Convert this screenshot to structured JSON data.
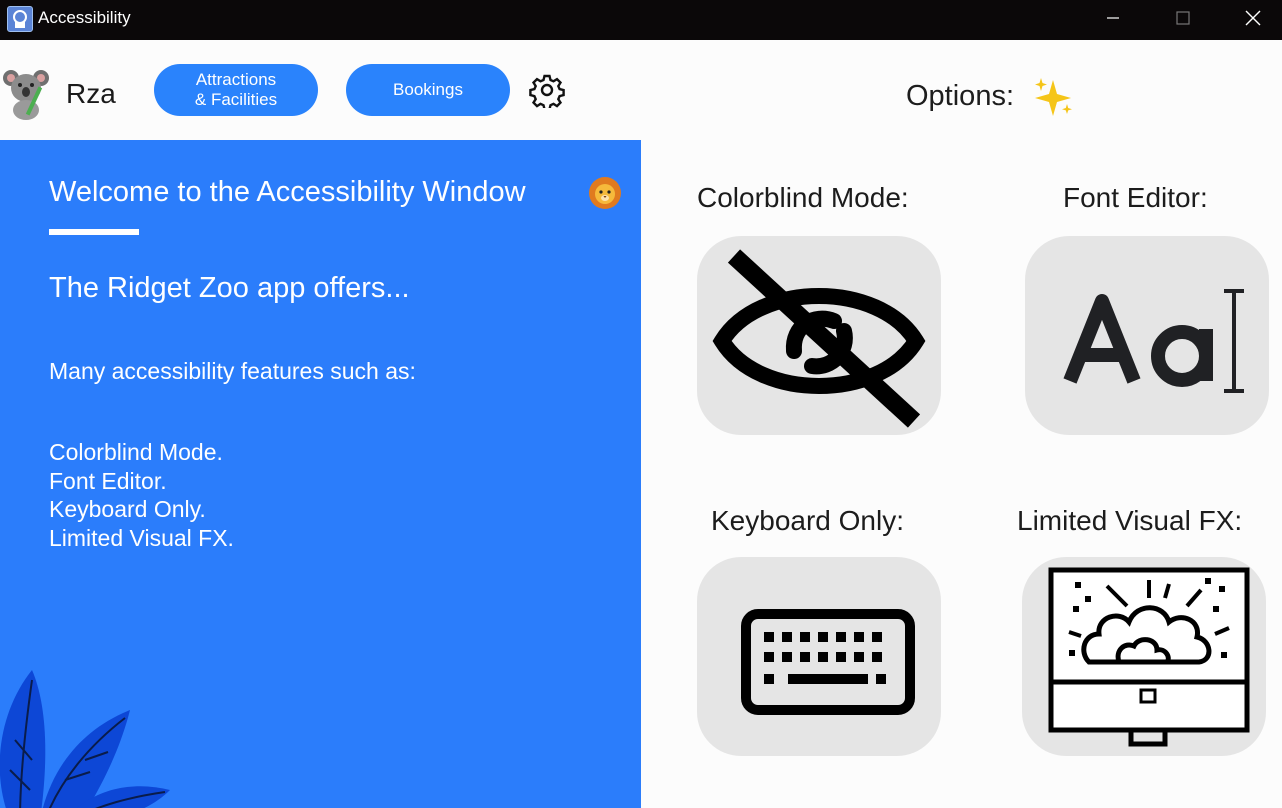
{
  "window": {
    "title": "Accessibility"
  },
  "header": {
    "brand": "Rza",
    "nav": [
      {
        "line1": "Attractions",
        "line2": "& Facilities"
      },
      {
        "label": "Bookings"
      }
    ],
    "options_label": "Options:"
  },
  "panel": {
    "welcome": "Welcome to the Accessibility Window",
    "offers": "The Ridget Zoo app offers...",
    "many": "Many accessibility features such as:",
    "features": [
      "Colorblind Mode.",
      "Font Editor.",
      "Keyboard Only.",
      "Limited Visual FX."
    ]
  },
  "options": [
    {
      "label": "Colorblind Mode:",
      "icon": "eye-slash-icon"
    },
    {
      "label": "Font Editor:",
      "icon": "font-aa-icon"
    },
    {
      "label": "Keyboard Only:",
      "icon": "keyboard-icon"
    },
    {
      "label": "Limited Visual FX:",
      "icon": "monitor-fx-icon"
    }
  ],
  "colors": {
    "accent": "#2a83fc",
    "panel": "#2b7dfb",
    "titlebar": "#0b0809",
    "tile": "#e5e5e5"
  }
}
